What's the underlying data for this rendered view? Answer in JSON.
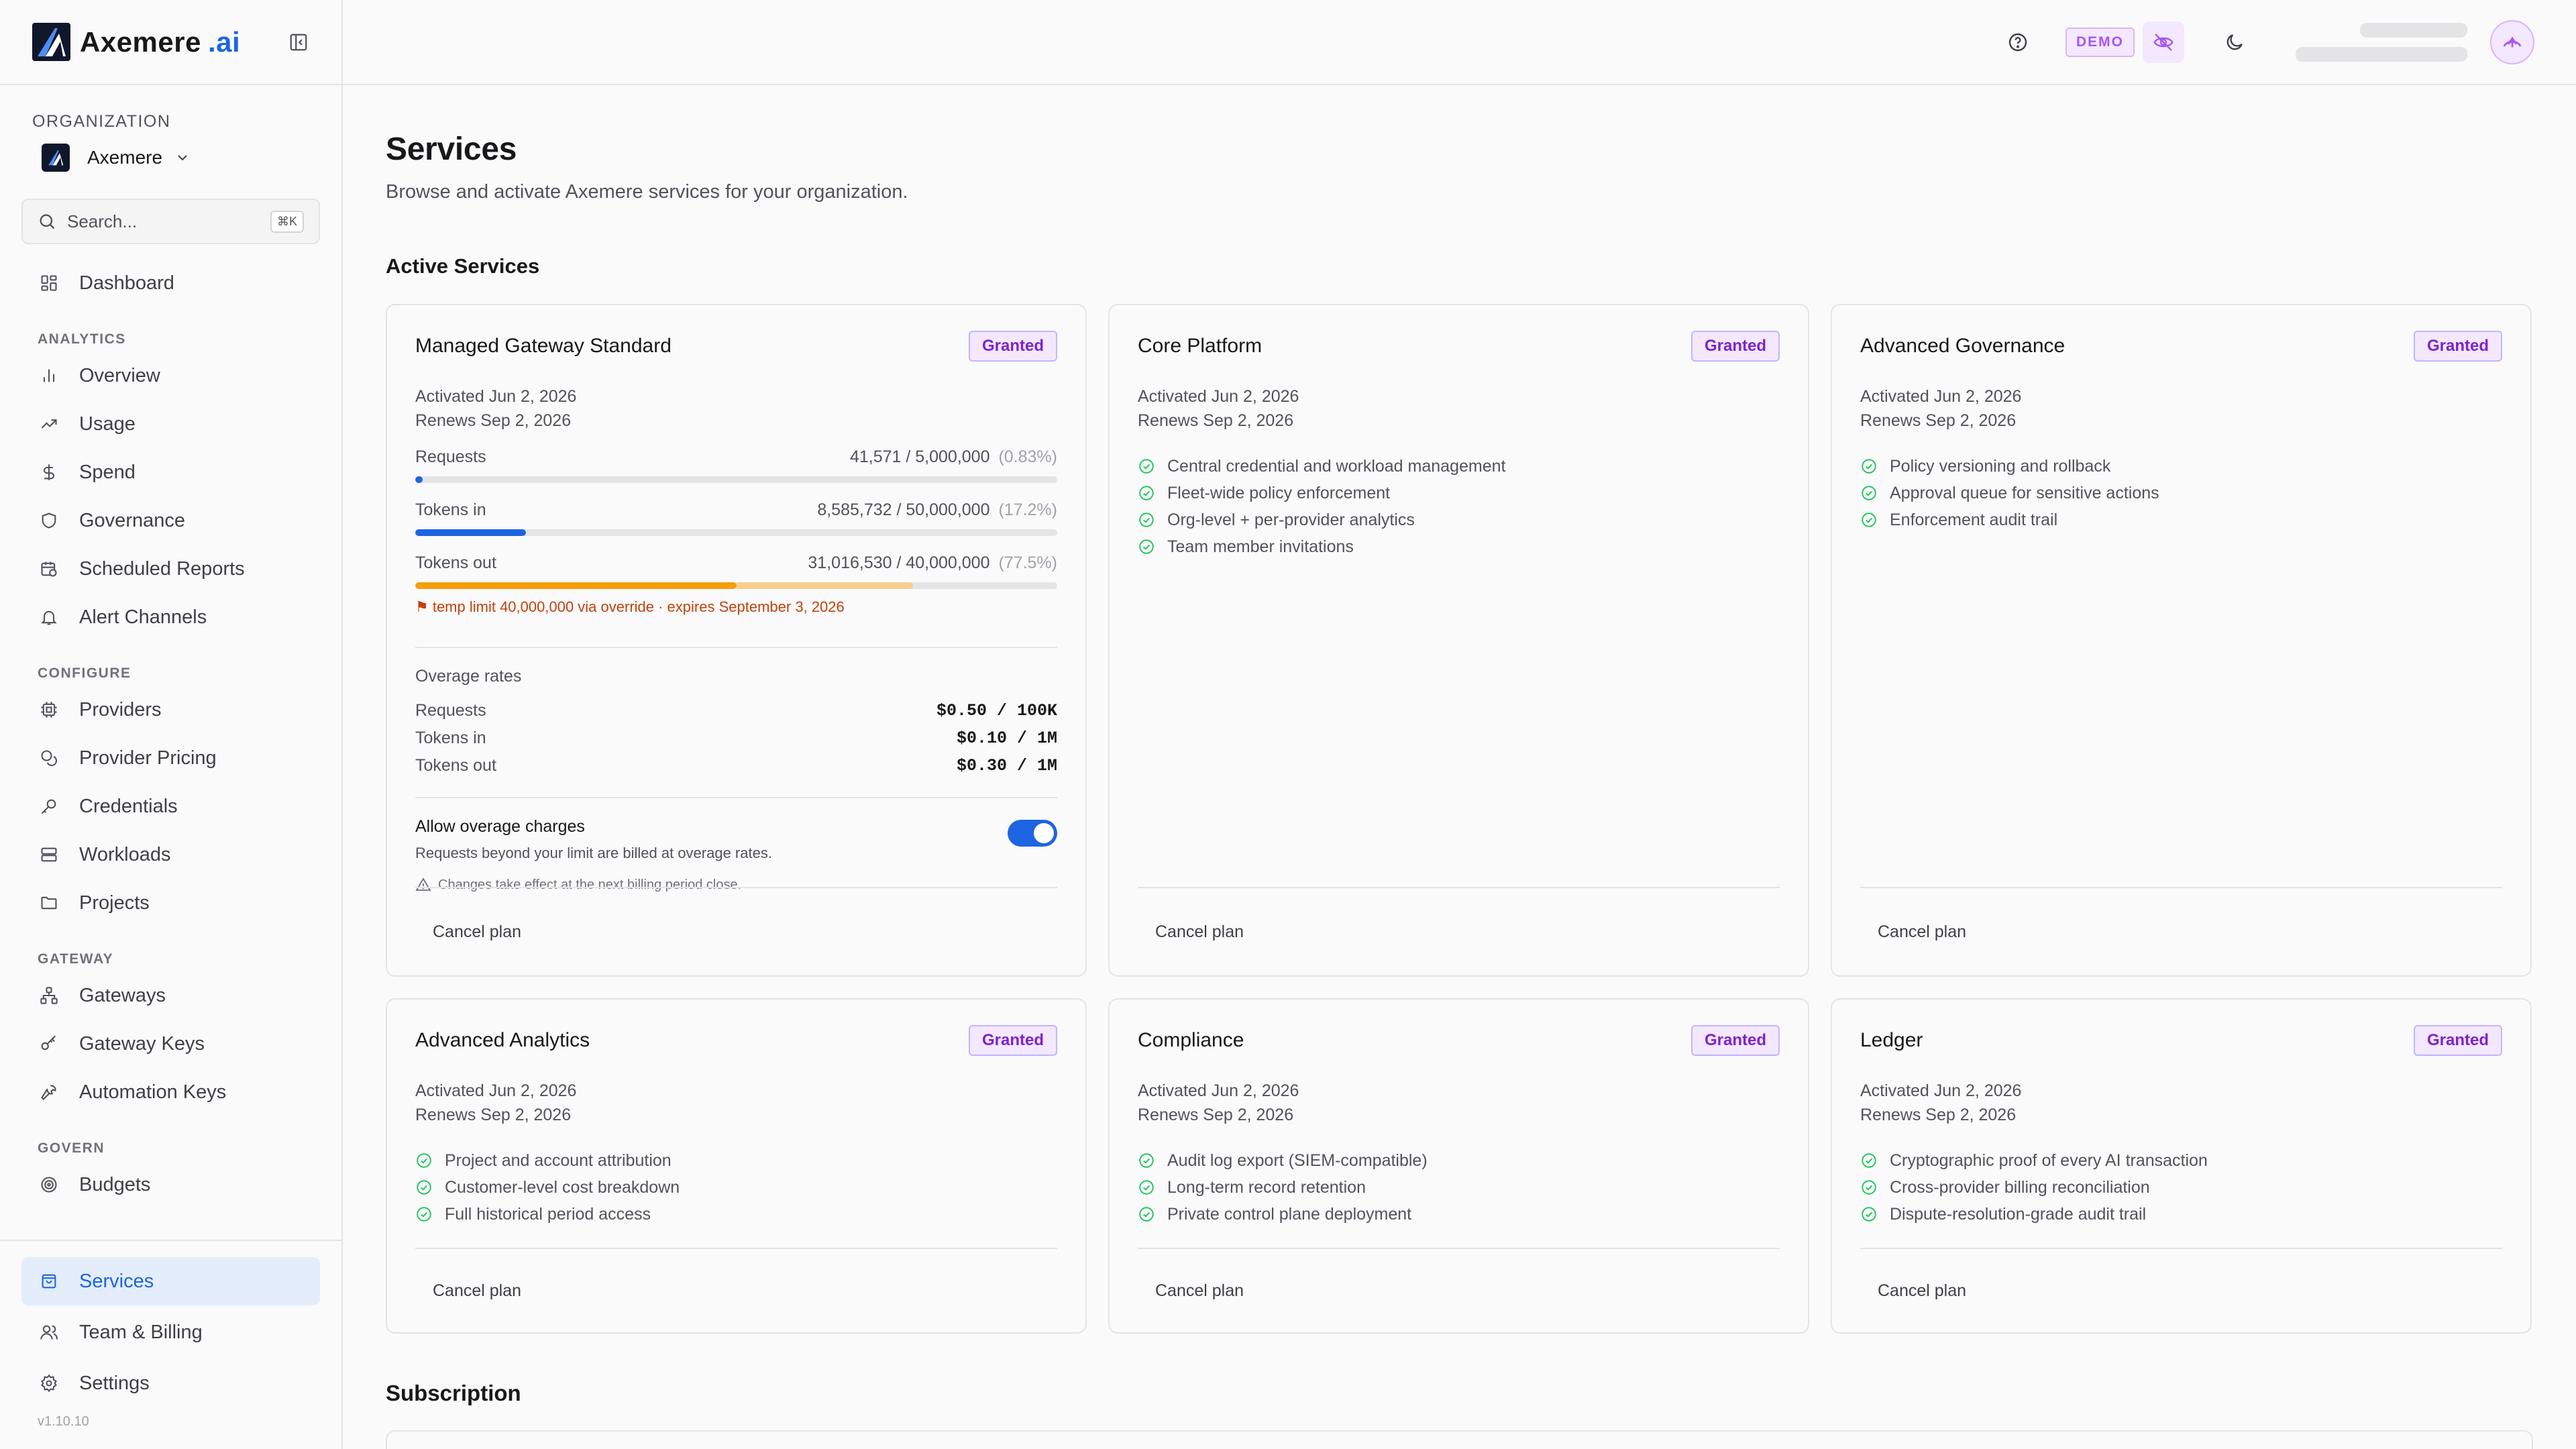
{
  "brand": {
    "name": "Axemere",
    "suffix": ".ai"
  },
  "org": {
    "label": "ORGANIZATION",
    "name": "Axemere"
  },
  "search": {
    "placeholder": "Search...",
    "shortcut": "⌘K"
  },
  "nav": {
    "dashboard": "Dashboard",
    "groups": {
      "analytics": "ANALYTICS",
      "configure": "CONFIGURE",
      "gateway": "GATEWAY",
      "govern": "GOVERN"
    },
    "analytics": [
      "Overview",
      "Usage",
      "Spend",
      "Governance",
      "Scheduled Reports",
      "Alert Channels"
    ],
    "configure": [
      "Providers",
      "Provider Pricing",
      "Credentials",
      "Workloads",
      "Projects"
    ],
    "gateway": [
      "Gateways",
      "Gateway Keys",
      "Automation Keys"
    ],
    "govern": [
      "Budgets"
    ],
    "bottom": [
      "Services",
      "Team & Billing",
      "Settings"
    ],
    "active": "Services",
    "version": "v1.10.10"
  },
  "topbar": {
    "demo": "DEMO"
  },
  "page": {
    "title": "Services",
    "subtitle": "Browse and activate Axemere services for your organization.",
    "active_section": "Active Services",
    "subscription_section": "Subscription"
  },
  "cards": [
    {
      "title": "Managed Gateway Standard",
      "badge": "Granted",
      "activated": "Activated Jun 2, 2026",
      "renews": "Renews Sep 2, 2026",
      "usage": [
        {
          "label": "Requests",
          "value": "41,571 / 5,000,000",
          "pct": "(0.83%)",
          "fraction": 0.0083
        },
        {
          "label": "Tokens in",
          "value": "8,585,732 / 50,000,000",
          "pct": "(17.2%)",
          "fraction": 0.172
        },
        {
          "label": "Tokens out",
          "value": "31,016,530 / 40,000,000",
          "pct": "(77.5%)",
          "fraction": 0.775,
          "base_fraction": 0.5
        }
      ],
      "warning": "⚑ temp limit 40,000,000 via override · expires September 3, 2026",
      "rates_title": "Overage rates",
      "rates": [
        {
          "label": "Requests",
          "value": "$0.50 / 100K"
        },
        {
          "label": "Tokens in",
          "value": "$0.10 / 1M"
        },
        {
          "label": "Tokens out",
          "value": "$0.30 / 1M"
        }
      ],
      "overage_title": "Allow overage charges",
      "overage_desc": "Requests beyond your limit are billed at overage rates.",
      "overage_note": "Changes take effect at the next billing period close.",
      "cancel": "Cancel plan"
    },
    {
      "title": "Core Platform",
      "badge": "Granted",
      "activated": "Activated Jun 2, 2026",
      "renews": "Renews Sep 2, 2026",
      "features": [
        "Central credential and workload management",
        "Fleet-wide policy enforcement",
        "Org-level + per-provider analytics",
        "Team member invitations"
      ],
      "cancel": "Cancel plan"
    },
    {
      "title": "Advanced Governance",
      "badge": "Granted",
      "activated": "Activated Jun 2, 2026",
      "renews": "Renews Sep 2, 2026",
      "features": [
        "Policy versioning and rollback",
        "Approval queue for sensitive actions",
        "Enforcement audit trail"
      ],
      "cancel": "Cancel plan"
    },
    {
      "title": "Advanced Analytics",
      "badge": "Granted",
      "activated": "Activated Jun 2, 2026",
      "renews": "Renews Sep 2, 2026",
      "features": [
        "Project and account attribution",
        "Customer-level cost breakdown",
        "Full historical period access"
      ],
      "cancel": "Cancel plan"
    },
    {
      "title": "Compliance",
      "badge": "Granted",
      "activated": "Activated Jun 2, 2026",
      "renews": "Renews Sep 2, 2026",
      "features": [
        "Audit log export (SIEM-compatible)",
        "Long-term record retention",
        "Private control plane deployment"
      ],
      "cancel": "Cancel plan"
    },
    {
      "title": "Ledger",
      "badge": "Granted",
      "activated": "Activated Jun 2, 2026",
      "renews": "Renews Sep 2, 2026",
      "features": [
        "Cryptographic proof of every AI transaction",
        "Cross-provider billing reconciliation",
        "Dispute-resolution-grade audit trail"
      ],
      "cancel": "Cancel plan"
    }
  ],
  "colors": {
    "accent": "#1d64e3",
    "badge_purple": "#7e22ce",
    "success": "#22c55e",
    "warn": "#f59e0b"
  }
}
